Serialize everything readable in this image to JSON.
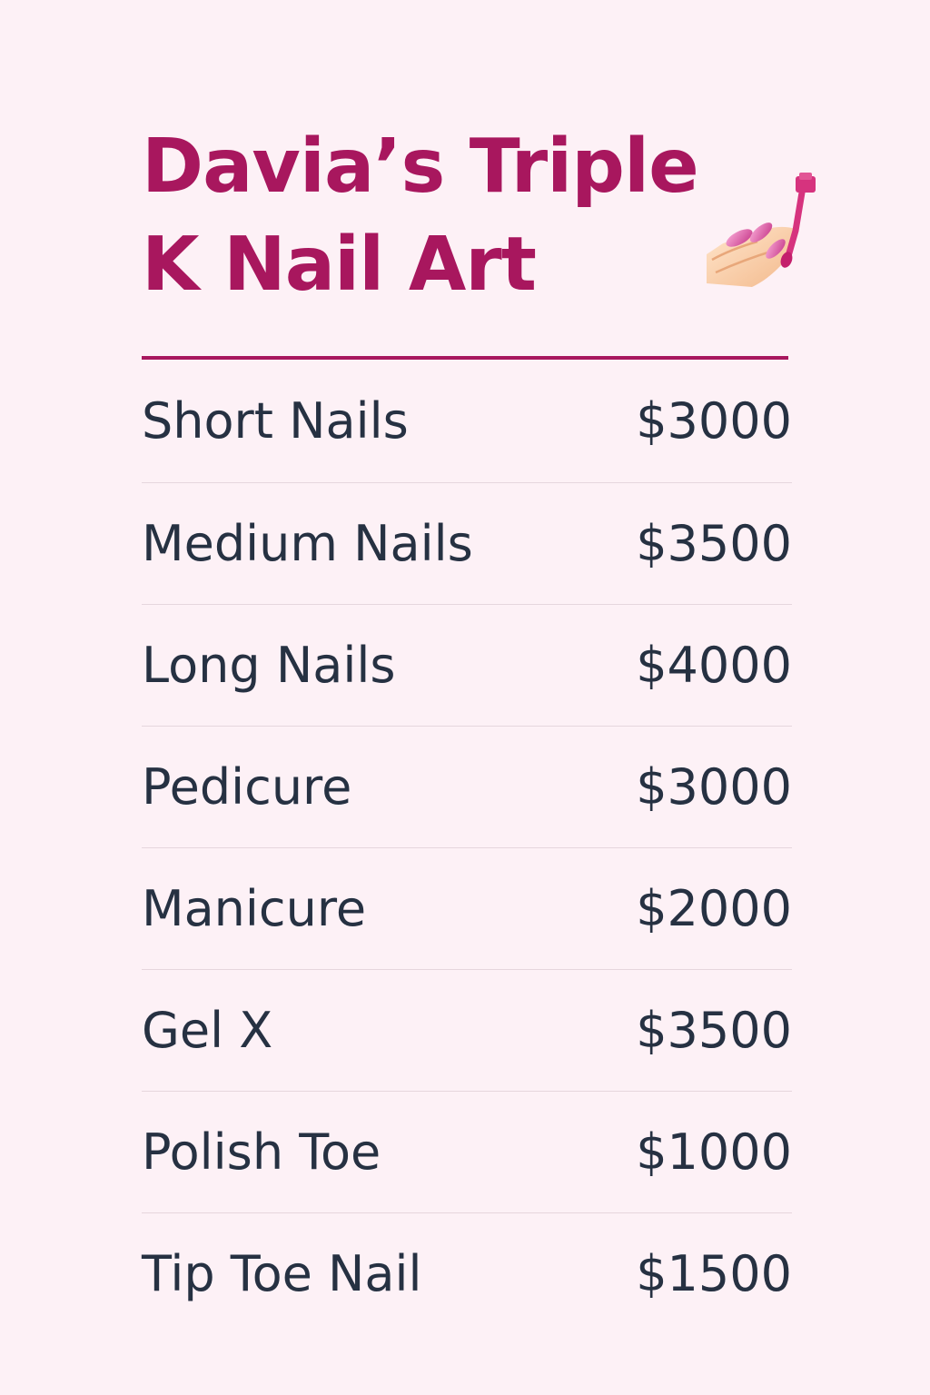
{
  "header": {
    "title": "Davia’s Triple K Nail Art",
    "icon": "nail-polish-icon"
  },
  "menu": {
    "items": [
      {
        "name": "Short Nails",
        "price": "$3000"
      },
      {
        "name": "Medium Nails",
        "price": "$3500"
      },
      {
        "name": "Long Nails",
        "price": "$4000"
      },
      {
        "name": "Pedicure",
        "price": "$3000"
      },
      {
        "name": "Manicure",
        "price": "$2000"
      },
      {
        "name": "Gel X",
        "price": "$3500"
      },
      {
        "name": "Polish Toe",
        "price": "$1000"
      },
      {
        "name": "Tip Toe Nail",
        "price": "$1500"
      }
    ]
  },
  "colors": {
    "background": "#fdf1f6",
    "accent": "#a8175e",
    "text": "#263142",
    "divider": "#e6d6dd"
  }
}
